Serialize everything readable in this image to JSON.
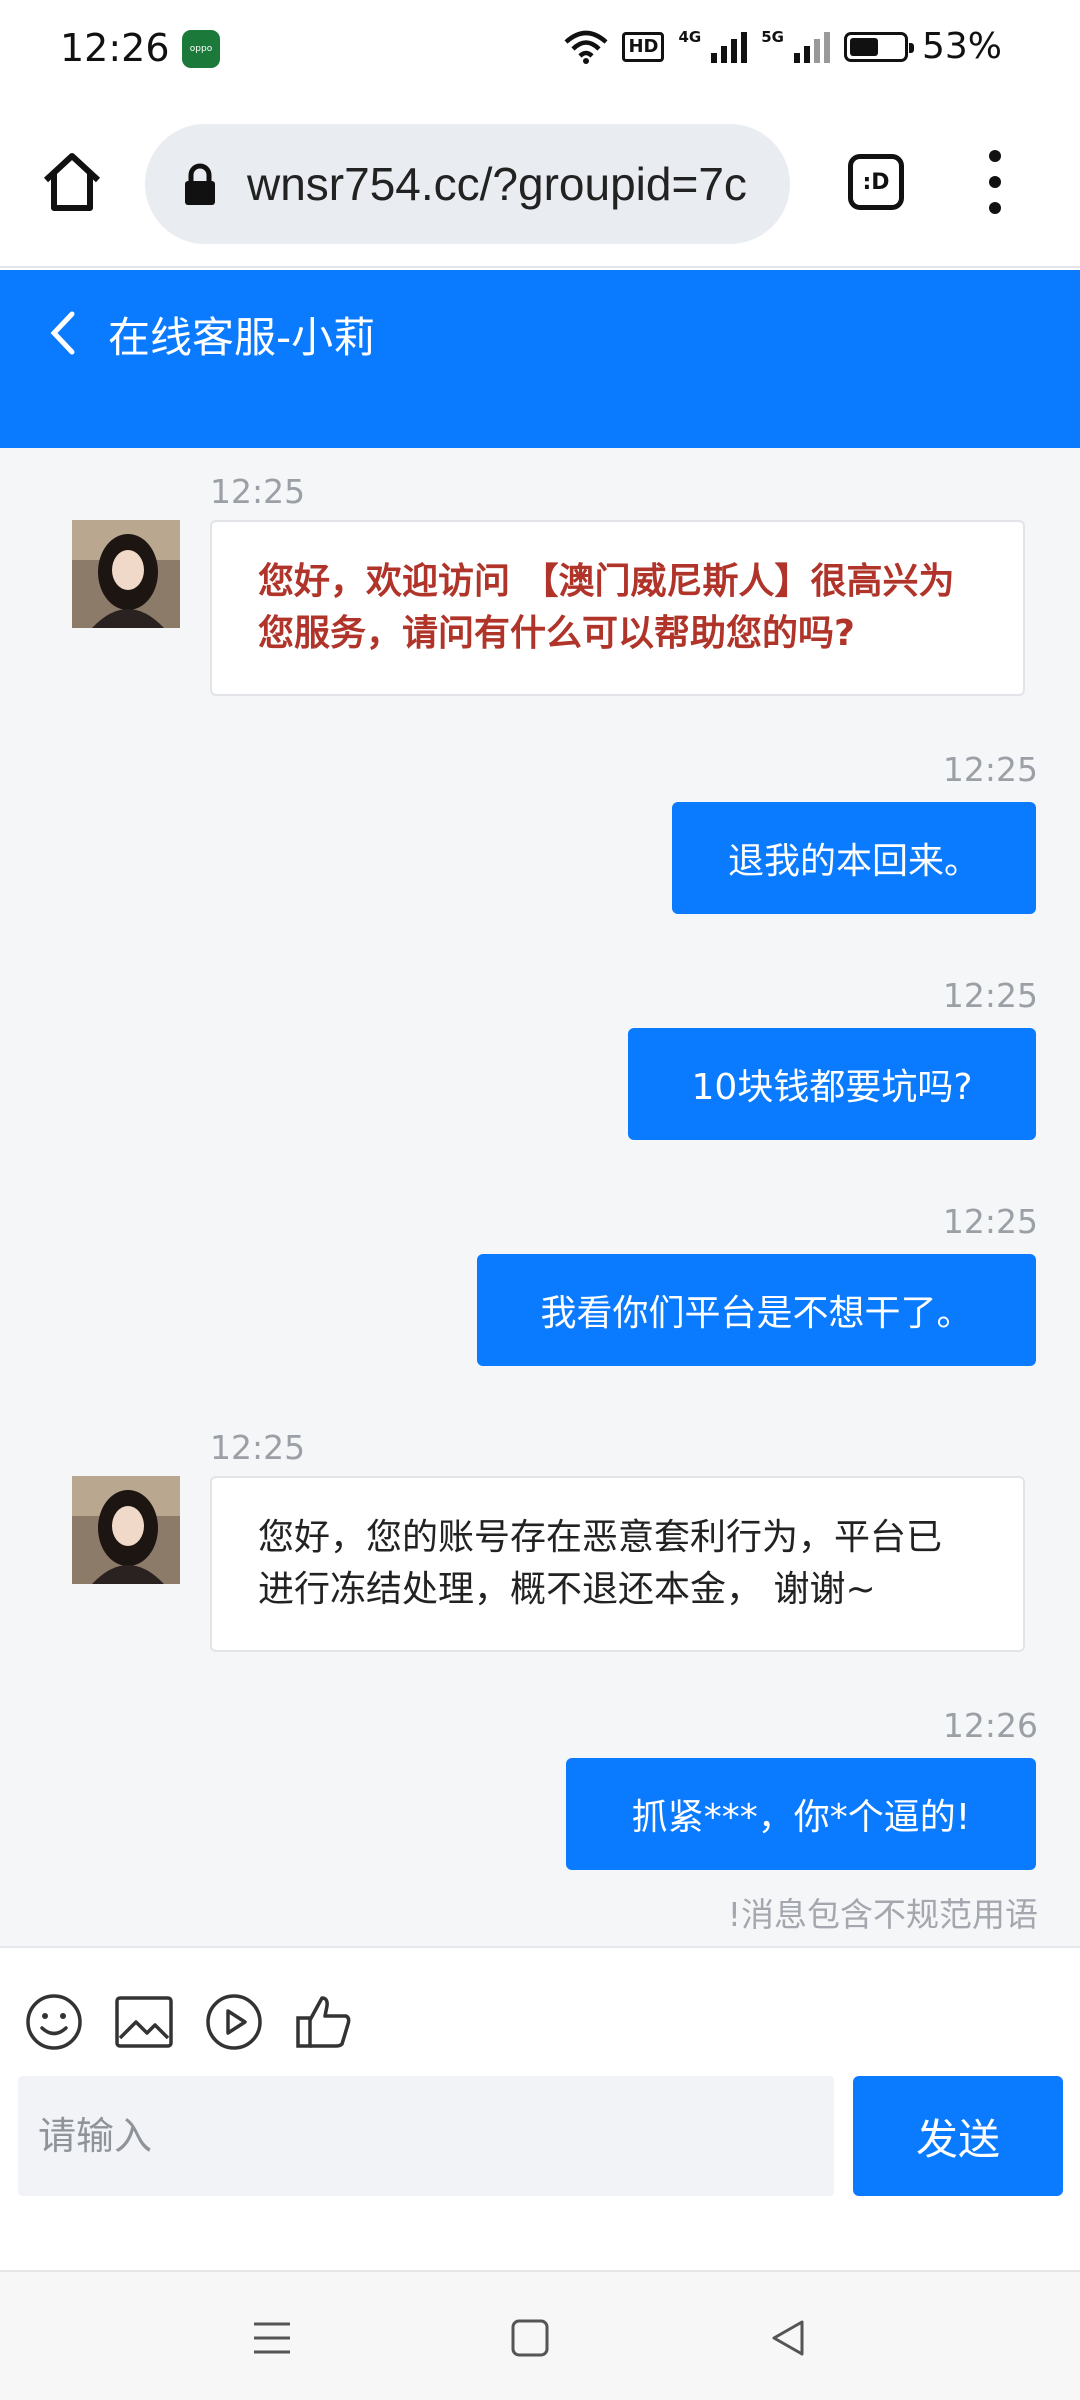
{
  "status_bar": {
    "time": "12:26",
    "app_badge": "oppo",
    "hd_label": "HD",
    "net1": "4G",
    "net2": "5G",
    "battery_pct": "53%",
    "battery_level": 0.53
  },
  "browser": {
    "url": "wnsr754.cc/?groupid=7c",
    "tabs_label": ":D"
  },
  "chat_header": {
    "title": "在线客服-小莉"
  },
  "messages": [
    {
      "side": "in",
      "time": "12:25",
      "text": "您好，欢迎访问 【澳门威尼斯人】很高兴为您服务，请问有什么可以帮助您的吗?"
    },
    {
      "side": "out",
      "time": "12:25",
      "text": "退我的本回来。"
    },
    {
      "side": "out",
      "time": "12:25",
      "text": "10块钱都要坑吗?"
    },
    {
      "side": "out",
      "time": "12:25",
      "text": "我看你们平台是不想干了。"
    },
    {
      "side": "in",
      "time": "12:25",
      "text": "您好，您的账号存在恶意套利行为，平台已进行冻结处理，概不退还本金， 谢谢~"
    },
    {
      "side": "out",
      "time": "12:26",
      "text": "抓紧***，你*个逼的!"
    }
  ],
  "warning_note": "!消息包含不规范用语",
  "composer": {
    "input_placeholder": "请输入",
    "send_label": "发送",
    "tools": [
      "emoji-icon",
      "image-icon",
      "video-icon",
      "thumbs-up-icon"
    ]
  },
  "colors": {
    "accent": "#0a7aff",
    "agent_greeting_text": "#b0342a"
  }
}
